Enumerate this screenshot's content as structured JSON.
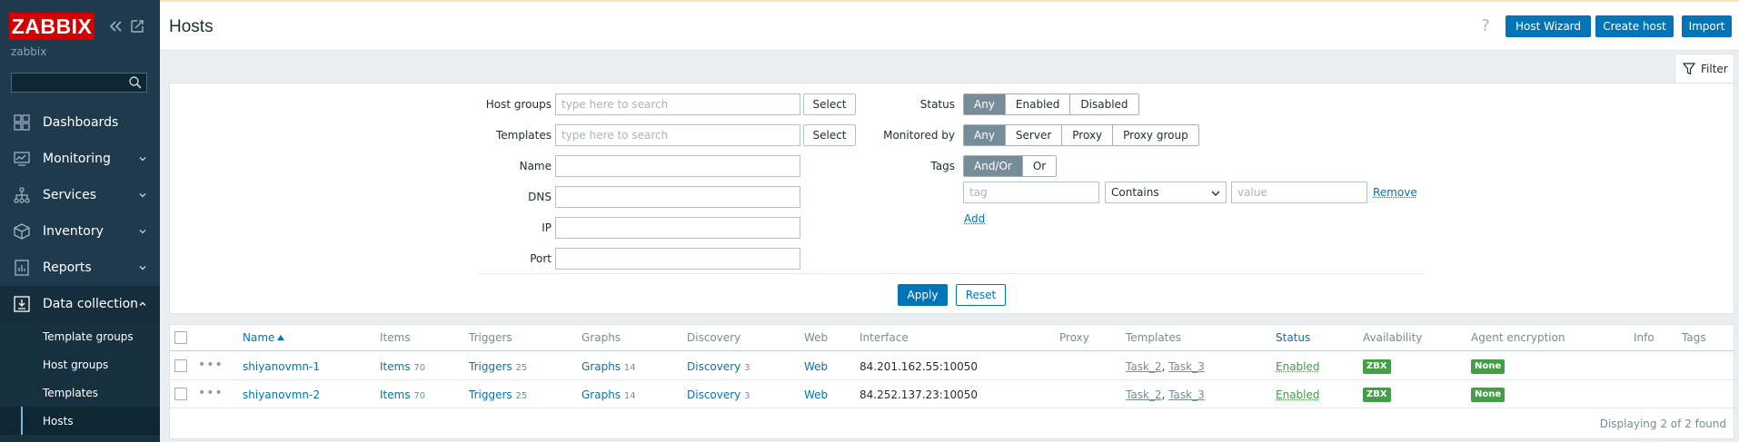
{
  "sidebar": {
    "logo": "ZABBIX",
    "user": "zabbix",
    "search_placeholder": "",
    "nav": [
      {
        "label": "Dashboards"
      },
      {
        "label": "Monitoring"
      },
      {
        "label": "Services"
      },
      {
        "label": "Inventory"
      },
      {
        "label": "Reports"
      },
      {
        "label": "Data collection"
      }
    ],
    "sub": [
      {
        "label": "Template groups"
      },
      {
        "label": "Host groups"
      },
      {
        "label": "Templates"
      },
      {
        "label": "Hosts"
      }
    ]
  },
  "header": {
    "title": "Hosts",
    "help": "?",
    "host_wizard": "Host Wizard",
    "create_host": "Create host",
    "import": "Import"
  },
  "filter": {
    "tab_label": "Filter",
    "host_groups_label": "Host groups",
    "host_groups_placeholder": "type here to search",
    "templates_label": "Templates",
    "templates_placeholder": "type here to search",
    "select_label": "Select",
    "name_label": "Name",
    "dns_label": "DNS",
    "ip_label": "IP",
    "port_label": "Port",
    "status_label": "Status",
    "status_options": [
      "Any",
      "Enabled",
      "Disabled"
    ],
    "monitored_label": "Monitored by",
    "monitored_options": [
      "Any",
      "Server",
      "Proxy",
      "Proxy group"
    ],
    "tags_label": "Tags",
    "tags_options": [
      "And/Or",
      "Or"
    ],
    "tag_placeholder": "tag",
    "operator": "Contains",
    "value_placeholder": "value",
    "remove": "Remove",
    "add": "Add",
    "apply": "Apply",
    "reset": "Reset"
  },
  "table": {
    "columns": [
      "Name",
      "Items",
      "Triggers",
      "Graphs",
      "Discovery",
      "Web",
      "Interface",
      "Proxy",
      "Templates",
      "Status",
      "Availability",
      "Agent encryption",
      "Info",
      "Tags"
    ],
    "rows": [
      {
        "name": "shiyanovmn-1",
        "items": "Items",
        "items_count": "70",
        "triggers": "Triggers",
        "triggers_count": "25",
        "graphs": "Graphs",
        "graphs_count": "14",
        "discovery": "Discovery",
        "discovery_count": "3",
        "web": "Web",
        "interface": "84.201.162.55:10050",
        "template1": "Task_2",
        "template2": "Task_3",
        "status": "Enabled",
        "availability": "ZBX",
        "encryption": "None"
      },
      {
        "name": "shiyanovmn-2",
        "items": "Items",
        "items_count": "70",
        "triggers": "Triggers",
        "triggers_count": "25",
        "graphs": "Graphs",
        "graphs_count": "14",
        "discovery": "Discovery",
        "discovery_count": "3",
        "web": "Web",
        "interface": "84.252.137.23:10050",
        "template1": "Task_2",
        "template2": "Task_3",
        "status": "Enabled",
        "availability": "ZBX",
        "encryption": "None"
      }
    ],
    "footer": "Displaying 2 of 2 found"
  },
  "colors": {
    "sidebar_bg": "#1f3a4d",
    "accent": "#0275b8",
    "logo_red": "#d40000",
    "status_green": "#429e47"
  }
}
